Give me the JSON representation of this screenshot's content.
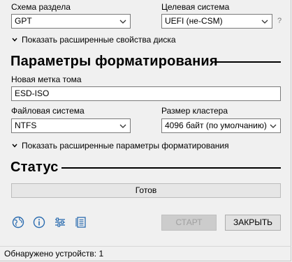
{
  "partition": {
    "label": "Схема раздела",
    "value": "GPT"
  },
  "target": {
    "label": "Целевая система",
    "value": "UEFI (не-CSM)",
    "help": "?"
  },
  "adv_drive_toggle": {
    "label": "Показать расширенные свойства диска"
  },
  "format_section": {
    "title": "Параметры форматирования"
  },
  "volume": {
    "label": "Новая метка тома",
    "value": "ESD-ISO"
  },
  "filesystem": {
    "label": "Файловая система",
    "value": "NTFS"
  },
  "cluster": {
    "label": "Размер кластера",
    "value": "4096 байт (по умолчанию)"
  },
  "adv_format_toggle": {
    "label": "Показать расширенные параметры форматирования"
  },
  "status_section": {
    "title": "Статус"
  },
  "progress": {
    "text": "Готов",
    "value": 0
  },
  "buttons": {
    "start": "СТАРТ",
    "close": "ЗАКРЫТЬ"
  },
  "toolbar_icons": [
    "globe-icon",
    "info-icon",
    "settings-sliders-icon",
    "log-icon"
  ],
  "colors": {
    "accent": "#2b6cb0",
    "progress_fill": "#06b025"
  },
  "statusbar": {
    "text": "Обнаружено устройств: 1"
  }
}
